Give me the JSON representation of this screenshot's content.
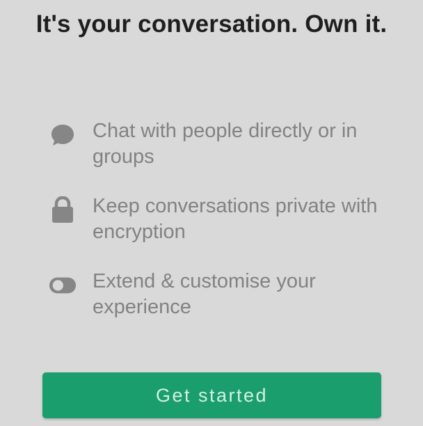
{
  "headline": "It's your conversation. Own it.",
  "features": [
    {
      "icon": "chat-bubble-icon",
      "text": "Chat with people directly or in groups"
    },
    {
      "icon": "lock-icon",
      "text": "Keep conversations private with encryption"
    },
    {
      "icon": "toggle-icon",
      "text": "Extend & customise your experience"
    }
  ],
  "cta": {
    "label": "Get started"
  },
  "colors": {
    "background": "#d9d9d9",
    "headline": "#1e1e1e",
    "feature_text": "#828282",
    "icon": "#868686",
    "button": "#1a9e6e",
    "button_text": "#d6efe4"
  }
}
